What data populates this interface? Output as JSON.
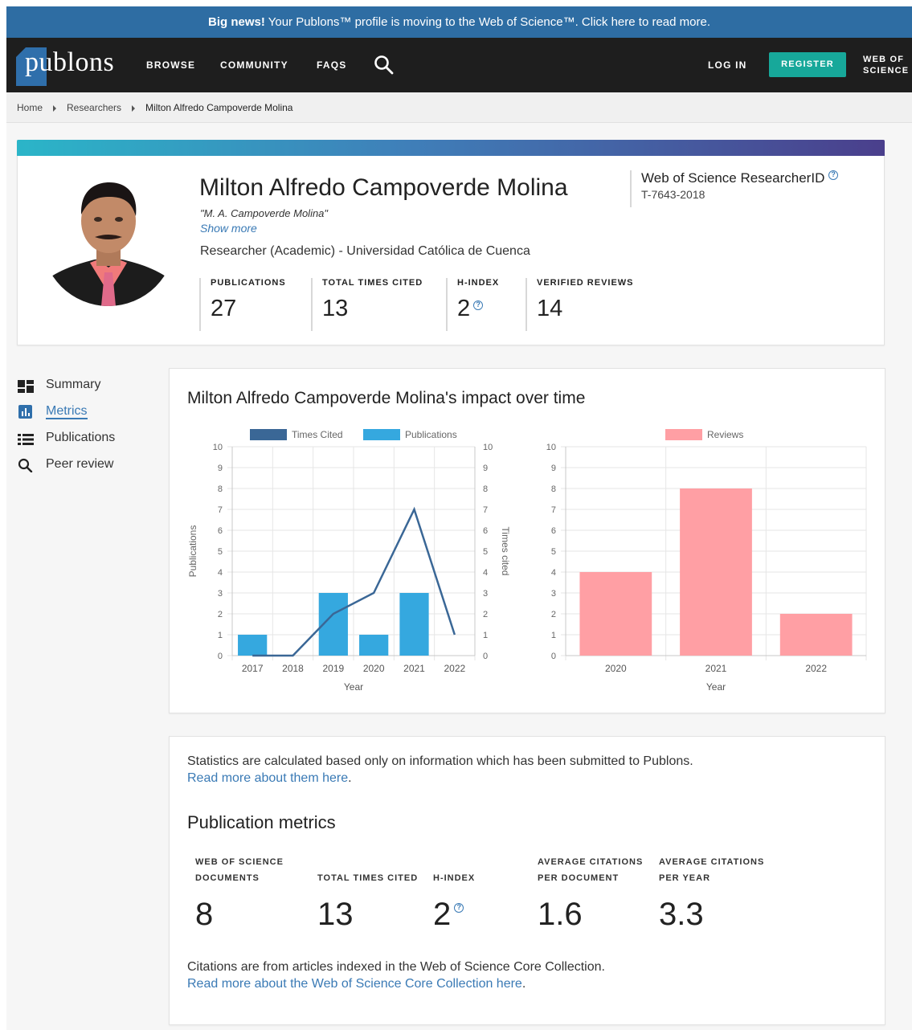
{
  "banner": {
    "bold": "Big news!",
    "text": " Your Publons™ profile is moving to the Web of Science™. Click here to read more."
  },
  "nav": {
    "logo": "publons",
    "items": [
      "BROWSE",
      "COMMUNITY",
      "FAQS"
    ],
    "login": "LOG IN",
    "register": "REGISTER",
    "wos_line1": "WEB OF",
    "wos_line2": "SCIENCE"
  },
  "breadcrumb": [
    "Home",
    "Researchers",
    "Milton Alfredo Campoverde Molina"
  ],
  "profile": {
    "name": "Milton Alfredo Campoverde Molina",
    "alias": "\"M. A. Campoverde Molina\"",
    "show_more": "Show more",
    "affiliation": "Researcher (Academic) - Universidad Católica de Cuenca",
    "researcher_id_label": "Web of Science ResearcherID",
    "researcher_id": "T-7643-2018",
    "stats": [
      {
        "label": "PUBLICATIONS",
        "value": "27"
      },
      {
        "label": "TOTAL TIMES CITED",
        "value": "13"
      },
      {
        "label": "H-INDEX",
        "value": "2"
      },
      {
        "label": "VERIFIED REVIEWS",
        "value": "14"
      }
    ]
  },
  "sidebar": {
    "items": [
      {
        "label": "Summary",
        "icon": "dashboard-icon"
      },
      {
        "label": "Metrics",
        "icon": "bar-chart-icon"
      },
      {
        "label": "Publications",
        "icon": "list-icon"
      },
      {
        "label": "Peer review",
        "icon": "search-icon"
      }
    ],
    "active": "Metrics"
  },
  "impact": {
    "title": "Milton Alfredo Campoverde Molina's impact over time"
  },
  "chart_data": [
    {
      "type": "bar",
      "categories": [
        "2017",
        "2018",
        "2019",
        "2020",
        "2021",
        "2022"
      ],
      "series": [
        {
          "name": "Publications",
          "type": "bar",
          "axis": "left",
          "color": "#35a8df",
          "values": [
            1,
            0,
            3,
            1,
            3,
            0
          ]
        },
        {
          "name": "Times Cited",
          "type": "line",
          "axis": "right",
          "color": "#3a6796",
          "values": [
            0,
            0,
            2,
            3,
            7,
            1
          ]
        }
      ],
      "xlabel": "Year",
      "ylabel": "Publications",
      "ylabel_right": "Times cited",
      "ylim": [
        0,
        10
      ],
      "yticks": [
        0,
        1,
        2,
        3,
        4,
        5,
        6,
        7,
        8,
        9,
        10
      ],
      "legend": "top",
      "grid": true
    },
    {
      "type": "bar",
      "categories": [
        "2020",
        "2021",
        "2022"
      ],
      "series": [
        {
          "name": "Reviews",
          "color": "#ff9fa4",
          "values": [
            4,
            8,
            2
          ]
        }
      ],
      "xlabel": "Year",
      "ylim": [
        0,
        10
      ],
      "yticks": [
        0,
        1,
        2,
        3,
        4,
        5,
        6,
        7,
        8,
        9,
        10
      ],
      "legend": "top",
      "grid": true
    }
  ],
  "metrics": {
    "intro": "Statistics are calculated based only on information which has been submitted to Publons.",
    "intro_link": "Read more about them here",
    "heading": "Publication metrics",
    "stats": [
      {
        "line1": "WEB OF SCIENCE",
        "line2": "DOCUMENTS",
        "value": "8"
      },
      {
        "line1": "",
        "line2": "TOTAL TIMES CITED",
        "value": "13"
      },
      {
        "line1": "",
        "line2": "H-INDEX",
        "value": "2"
      },
      {
        "line1": "AVERAGE CITATIONS",
        "line2": "PER DOCUMENT",
        "value": "1.6"
      },
      {
        "line1": "AVERAGE CITATIONS",
        "line2": "PER YEAR",
        "value": "3.3"
      }
    ],
    "footer": "Citations are from articles indexed in the Web of Science Core Collection.",
    "footer_link": "Read more about the Web of Science Core Collection here"
  }
}
